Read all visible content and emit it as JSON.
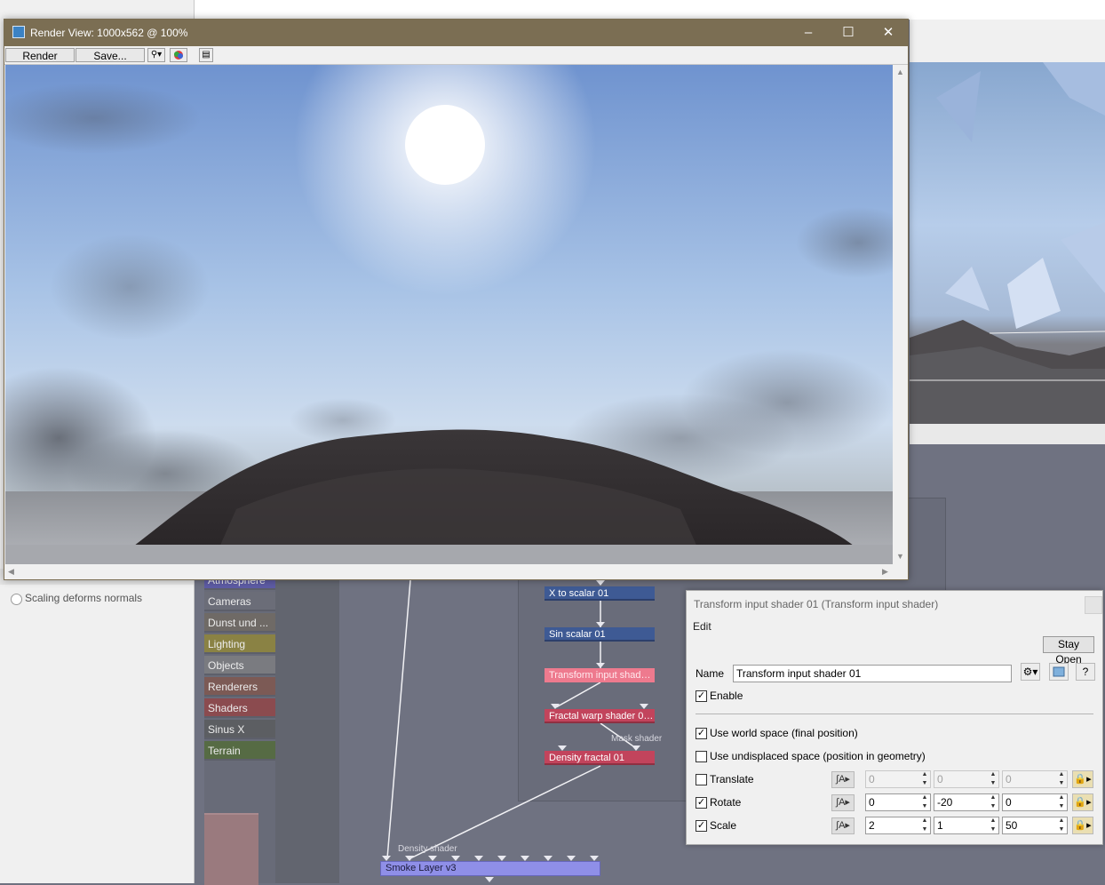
{
  "background": {
    "left_panel": {
      "scaling_label": "Scaling deforms normals"
    },
    "node_graph": {
      "categories": [
        {
          "label": "Atmosphere",
          "color": "#5d5ba3"
        },
        {
          "label": "Cameras",
          "color": "#6b6d78"
        },
        {
          "label": "Dunst und ...",
          "color": "#6f6a66"
        },
        {
          "label": "Lighting",
          "color": "#8a8244"
        },
        {
          "label": "Objects",
          "color": "#7a7b80"
        },
        {
          "label": "Renderers",
          "color": "#7c5a55"
        },
        {
          "label": "Shaders",
          "color": "#8b4b4f"
        },
        {
          "label": "Sinus X",
          "color": "#5c5e62"
        },
        {
          "label": "Terrain",
          "color": "#566b44"
        }
      ],
      "nodes": {
        "x_to_scalar": "X to scalar 01",
        "sin_scalar": "Sin scalar 01",
        "transform_input": "Transform input shader...",
        "fractal_warp": "Fractal warp shader 02...",
        "mask_shader_label": "Mask shader",
        "density_fractal": "Density fractal 01",
        "density_shader_label": "Density shader",
        "smoke_layer": "Smoke Layer v3"
      }
    }
  },
  "render_window": {
    "title": "Render View: 1000x562 @ 100%",
    "toolbar": {
      "render_label": "Render",
      "save_label": "Save..."
    },
    "window_buttons": {
      "minimize": "–",
      "maximize": "☐",
      "close": "✕"
    }
  },
  "dialog": {
    "title": "Transform input shader 01    (Transform input shader)",
    "menu_edit": "Edit",
    "stay_open": "Stay Open",
    "name_label": "Name",
    "name_value": "Transform input shader 01",
    "enable_label": "Enable",
    "enable_checked": true,
    "world_space_label": "Use world space (final position)",
    "world_space_checked": true,
    "undisplaced_label": "Use undisplaced space (position in geometry)",
    "undisplaced_checked": false,
    "help_label": "?",
    "rows": [
      {
        "label": "Translate",
        "checked": false,
        "values": [
          "0",
          "0",
          "0"
        ],
        "disabled": true
      },
      {
        "label": "Rotate",
        "checked": true,
        "values": [
          "0",
          "-20",
          "0"
        ],
        "disabled": false
      },
      {
        "label": "Scale",
        "checked": true,
        "values": [
          "2",
          "1",
          "50"
        ],
        "disabled": false
      }
    ]
  },
  "icons": {
    "app": "app-logo-icon",
    "zoom": "magnifier-icon",
    "color": "color-wheel-icon",
    "doc": "document-icon",
    "gear": "gear-icon",
    "preview": "preview-icon",
    "curve": "curve-icon",
    "lock": "lock-icon"
  },
  "colors": {
    "titlebar": "#7b6e53",
    "node_blue": "#3e5a94",
    "node_red": "#c2445c",
    "node_pink": "#ee7a8e",
    "smoke_layer": "#8f8fe8"
  }
}
